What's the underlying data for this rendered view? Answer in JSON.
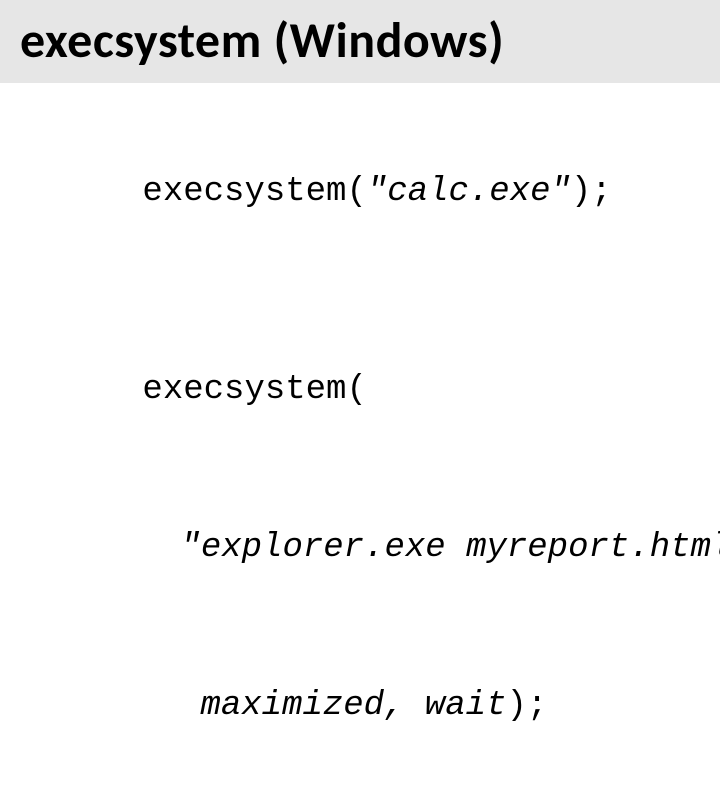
{
  "title": "execsystem (Windows)",
  "code": {
    "line1_func": "execsystem(",
    "line1_arg": "\"calc.exe\"",
    "line1_end": ");",
    "line2_func": "execsystem(",
    "line3_arg": "\"explorer.exe myreport.html\",",
    "line4_arg": "maximized, wait",
    "line4_end": ");"
  }
}
